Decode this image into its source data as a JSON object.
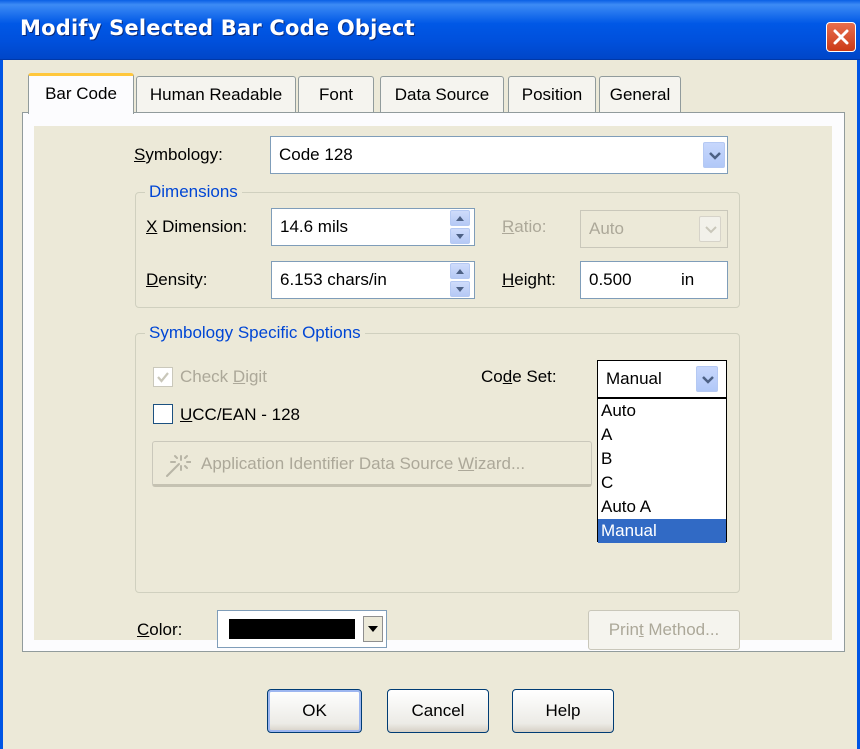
{
  "window": {
    "title": "Modify Selected Bar Code Object"
  },
  "tabs": [
    {
      "label": "Bar Code",
      "active": true
    },
    {
      "label": "Human Readable",
      "active": false
    },
    {
      "label": "Font",
      "active": false
    },
    {
      "label": "Data Source",
      "active": false
    },
    {
      "label": "Position",
      "active": false
    },
    {
      "label": "General",
      "active": false
    }
  ],
  "symbology": {
    "label_prefix": "",
    "label_key": "S",
    "label_rest": "ymbology:",
    "value": "Code 128"
  },
  "dimensions": {
    "title": "Dimensions",
    "x_dimension": {
      "label_key": "X",
      "label_rest": " Dimension:",
      "value": "14.6  mils"
    },
    "density": {
      "label_key": "D",
      "label_rest": "ensity:",
      "value": "6.153  chars/in"
    },
    "ratio": {
      "label_key": "R",
      "label_rest": "atio:",
      "value": "Auto"
    },
    "height": {
      "label_key": "H",
      "label_rest": "eight:",
      "value": "0.500",
      "unit": "in"
    }
  },
  "symbology_options": {
    "title": "Symbology Specific Options",
    "check_digit": {
      "label_pre": "Check ",
      "label_key": "D",
      "label_rest": "igit",
      "checked": true,
      "enabled": false
    },
    "ucc_ean": {
      "label_key": "U",
      "label_rest": "CC/EAN - 128",
      "checked": false
    },
    "code_set": {
      "label_pre": "Co",
      "label_key": "d",
      "label_rest": "e Set:",
      "value": "Manual"
    },
    "code_set_options": [
      "Auto",
      "A",
      "B",
      "C",
      "Auto A",
      "Manual"
    ],
    "code_set_selected": "Manual",
    "wizard_button": {
      "label_pre": "Application Identifier Data Source ",
      "label_key": "W",
      "label_rest": "izard..."
    }
  },
  "color": {
    "label_key": "C",
    "label_rest": "olor:",
    "value": "#000000"
  },
  "print_method": {
    "label_pre": "Prin",
    "label_key": "t",
    "label_rest": " Method..."
  },
  "buttons": {
    "ok": "OK",
    "cancel": "Cancel",
    "help": "Help"
  }
}
